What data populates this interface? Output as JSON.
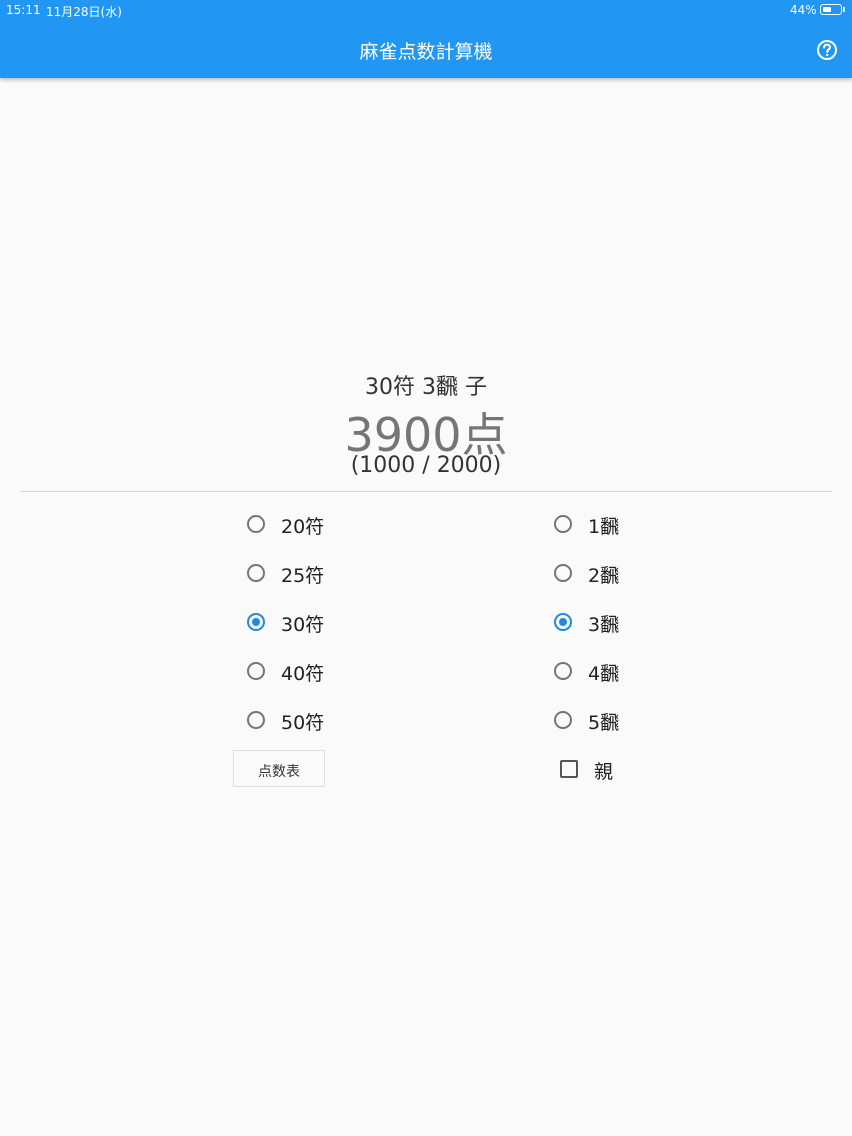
{
  "status_bar": {
    "time": "15:11",
    "date": "11月28日(水)",
    "battery_percent": "44%",
    "battery_level": 0.44
  },
  "app_bar": {
    "title": "麻雀点数計算機",
    "help_icon": "help-circle-icon",
    "color": "#2196f3"
  },
  "result": {
    "summary": "30符 3飜 子",
    "points": "3900点",
    "split": "(1000 / 2000)"
  },
  "fu_options": [
    {
      "label": "20符",
      "selected": false
    },
    {
      "label": "25符",
      "selected": false
    },
    {
      "label": "30符",
      "selected": true
    },
    {
      "label": "40符",
      "selected": false
    },
    {
      "label": "50符",
      "selected": false
    }
  ],
  "han_options": [
    {
      "label": "1飜",
      "selected": false
    },
    {
      "label": "2飜",
      "selected": false
    },
    {
      "label": "3飜",
      "selected": true
    },
    {
      "label": "4飜",
      "selected": false
    },
    {
      "label": "5飜",
      "selected": false
    }
  ],
  "score_table_button": "点数表",
  "dealer_checkbox": {
    "label": "親",
    "checked": false
  },
  "accent_color": "#1e88e5"
}
